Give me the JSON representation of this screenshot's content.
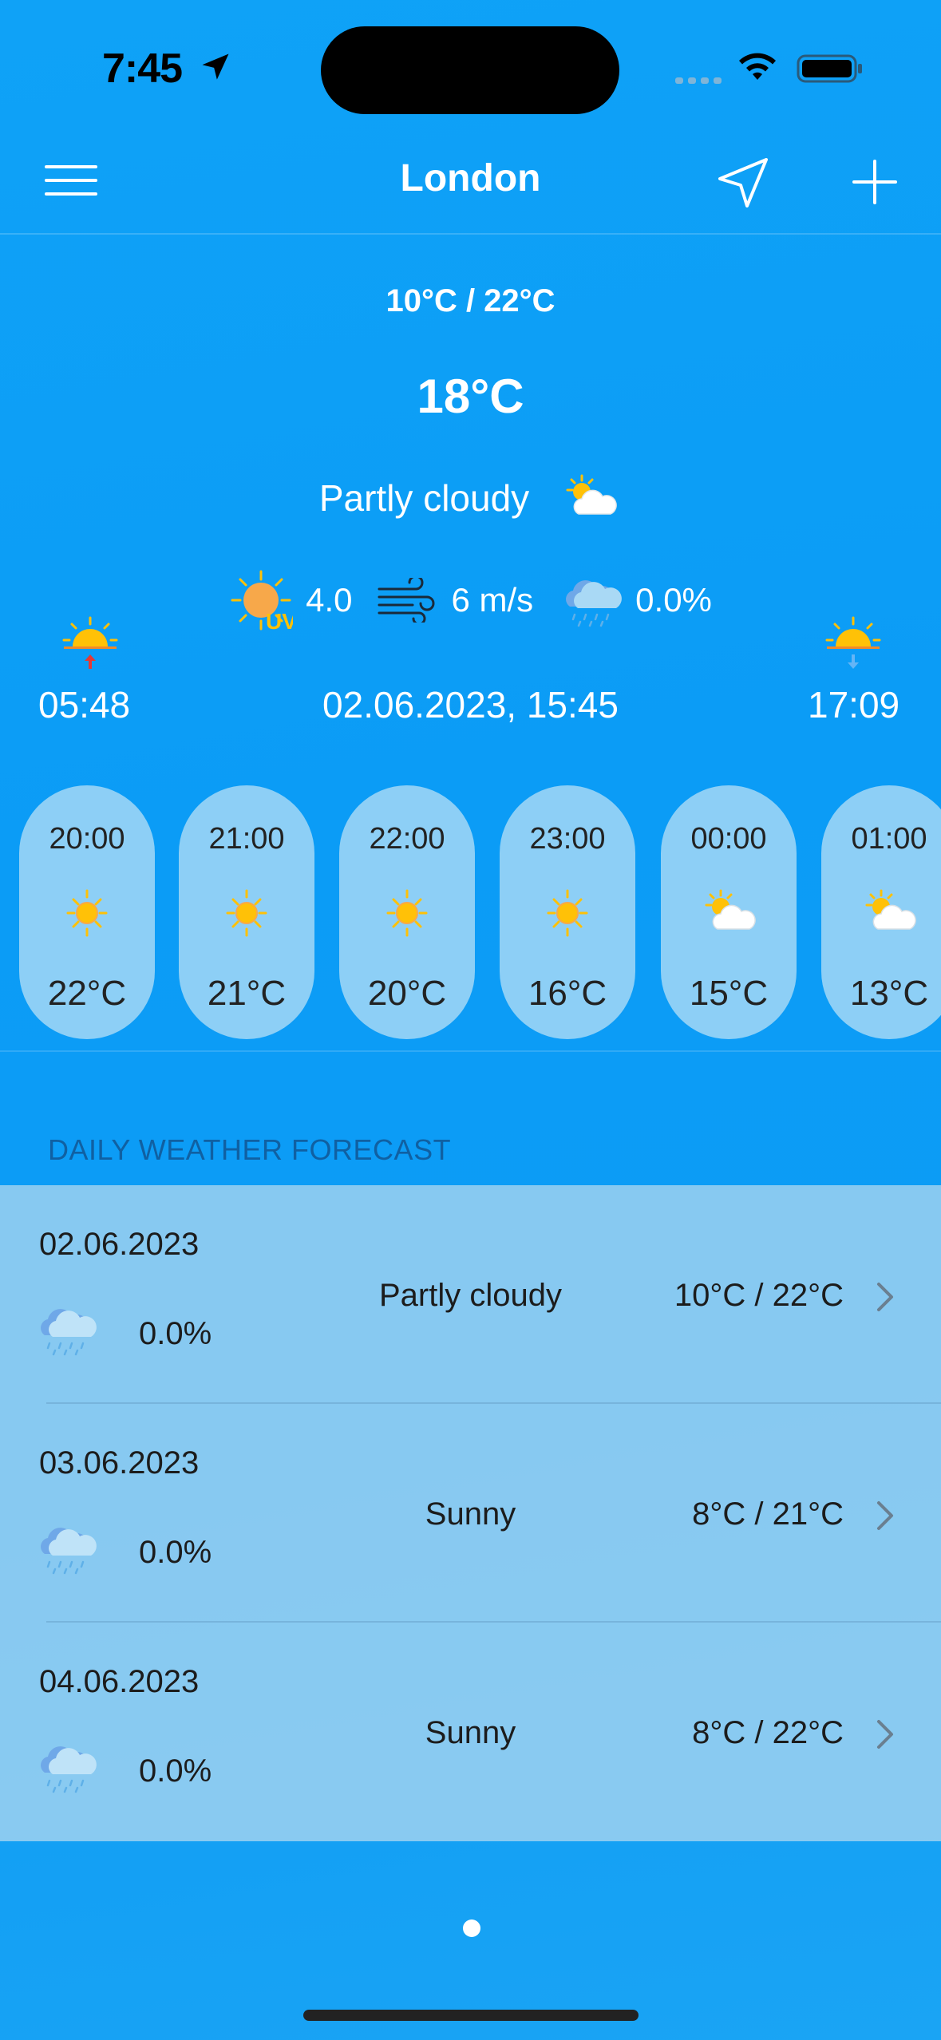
{
  "status_bar": {
    "time": "7:45"
  },
  "nav": {
    "title": "London"
  },
  "current": {
    "min_max": "10°C / 22°C",
    "temp": "18°C",
    "condition": "Partly cloudy",
    "uv": "4.0",
    "uv_badge": "UV",
    "wind": "6 m/s",
    "precip": "0.0%",
    "sunrise": "05:48",
    "sunset": "17:09",
    "datetime": "02.06.2023, 15:45"
  },
  "hourly": [
    {
      "time": "20:00",
      "icon": "sunny",
      "temp": "22°C"
    },
    {
      "time": "21:00",
      "icon": "sunny",
      "temp": "21°C"
    },
    {
      "time": "22:00",
      "icon": "sunny",
      "temp": "20°C"
    },
    {
      "time": "23:00",
      "icon": "sunny",
      "temp": "16°C"
    },
    {
      "time": "00:00",
      "icon": "partly-cloudy",
      "temp": "15°C"
    },
    {
      "time": "01:00",
      "icon": "partly-cloudy",
      "temp": "13°C"
    }
  ],
  "daily_header": "DAILY WEATHER FORECAST",
  "daily": [
    {
      "date": "02.06.2023",
      "precip": "0.0%",
      "condition": "Partly cloudy",
      "temps": "10°C / 22°C"
    },
    {
      "date": "03.06.2023",
      "precip": "0.0%",
      "condition": "Sunny",
      "temps": "8°C / 21°C"
    },
    {
      "date": "04.06.2023",
      "precip": "0.0%",
      "condition": "Sunny",
      "temps": "8°C / 22°C"
    }
  ],
  "colors": {
    "accent": "#0fa2f7",
    "sun": "#ffc107",
    "uv": "#f7a84a"
  }
}
